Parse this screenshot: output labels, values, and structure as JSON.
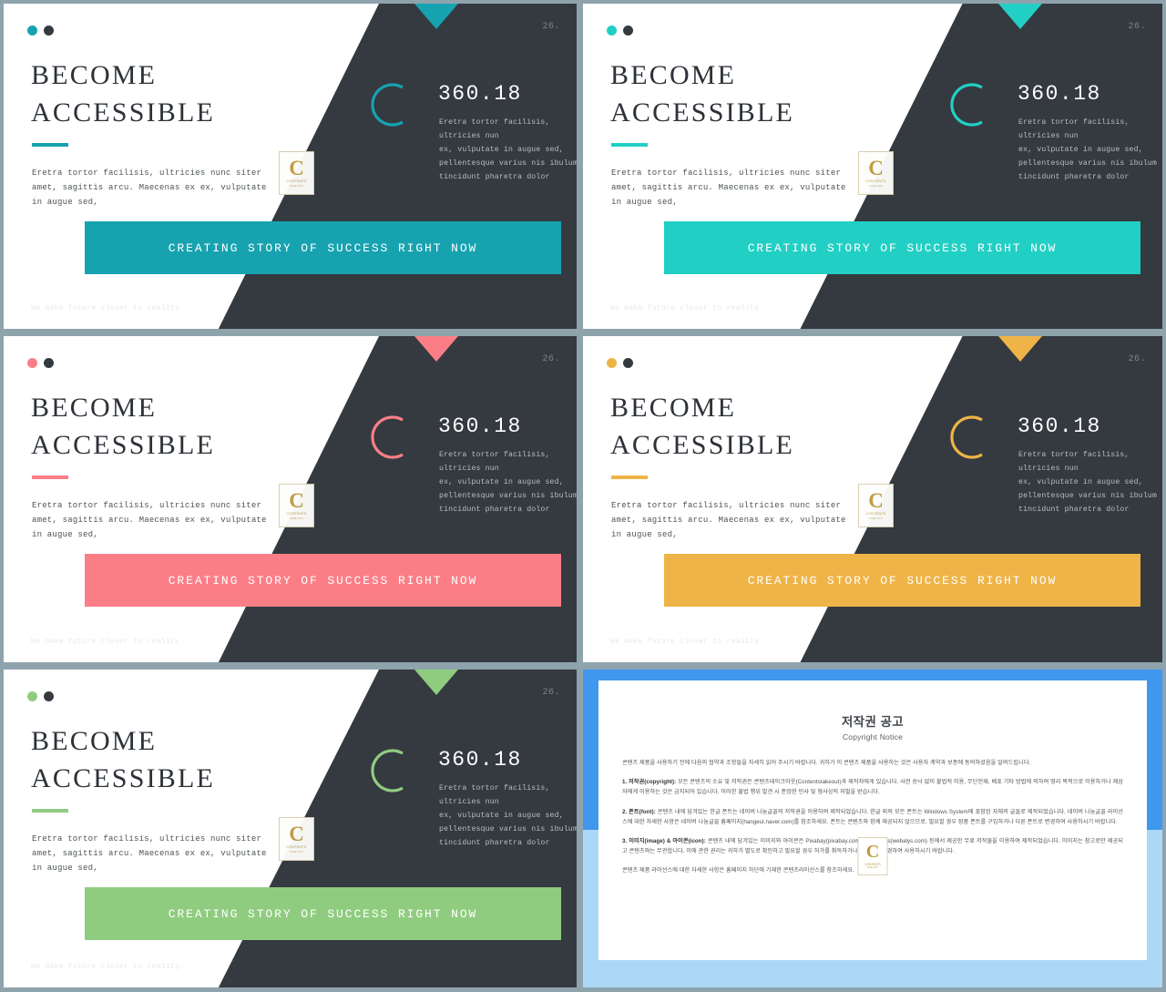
{
  "deck": {
    "page_number": "26.",
    "headline_line1": "BECOME",
    "headline_line2": "ACCESSIBLE",
    "stat_value": "360.18",
    "cta_label": "CREATING STORY OF SUCCESS RIGHT NOW",
    "tagline": "We make future closer to reality.",
    "left_paragraph": [
      "Eretra tortor facilisis, ultricies nunc siter",
      "amet, sagittis arcu. Maecenas ex ex, vulputate",
      "in augue sed,"
    ],
    "right_paragraph": [
      "Eretra tortor facilisis,",
      "ultricies nun",
      "ex, vulputate in augue sed,",
      "pellentesque varius nis ibulum",
      "tincidunt pharetra dolor"
    ],
    "logo": {
      "letter": "C",
      "name": "CONTENTS",
      "sub": "TAKE OUT"
    },
    "dark_color": "#343a40",
    "text_dark": "#2d3238"
  },
  "slides": [
    {
      "id": "slide-teal-dark",
      "accent": "#17a2b0",
      "accent_name": "teal"
    },
    {
      "id": "slide-turquoise",
      "accent": "#22cfc4",
      "accent_name": "turquoise"
    },
    {
      "id": "slide-coral",
      "accent": "#fb7e87",
      "accent_name": "coral"
    },
    {
      "id": "slide-amber",
      "accent": "#efb447",
      "accent_name": "amber"
    },
    {
      "id": "slide-green",
      "accent": "#90cc80",
      "accent_name": "green"
    }
  ],
  "copyright": {
    "title": "저작권 공고",
    "subtitle": "Copyright Notice",
    "frame_top_color": "#3f97ee",
    "frame_bottom_color": "#acd8f6",
    "paragraphs": [
      {
        "lead": "",
        "text": "콘텐츠 제품을 사용하기 전에 다음의 협약과 조항들을 자세히 읽어 주시기 바랍니다. 귀하가 이 콘텐츠 제품을 사용하는 것은 사용자 계약과 보증에 동의하셨음을 알려드립니다."
      },
      {
        "lead": "1. 저작권(copyright):",
        "text": " 모든 콘텐츠의 소유 및 저작권은 콘텐츠테이크아웃(Contentstakeout)과 제작자에게 있습니다. 사전 승낙 없이 불법적 이용, 무단전재, 배포 기타 방법에 의하여 영리 목적으로 이용하거나 제삼자에게 이용하는 것은 금지되어 있습니다. 이러한 불법 행위 발견 시 준엄한 민사 및 형사상의 처벌을 받습니다."
      },
      {
        "lead": "2. 폰트(font):",
        "text": " 콘텐츠 내에 담겨있는 한글 폰트는 네이버 나눔글꼴의 저작권을 이용하여 제작되었습니다. 한글 외의 모든 폰트는 Windows System에 포함된 자체의 글꼴로 제작되었습니다. 네이버 나눔글꼴 라이선스에 대한 자세한 사항은 네이버 나눔글꼴 홈페이지(hangeul.naver.com)를 참조하세요. 폰트는 콘텐츠와 함께 제공되지 않으므로, 필요할 경우 정품 폰트를 구입하거나 다른 폰트로 변경하여 사용하시기 바랍니다."
      },
      {
        "lead": "3. 이미지(image) & 아이콘(icon):",
        "text": " 콘텐츠 내에 담겨있는 이미지와 아이콘은 Pixabay(pixabay.com)와 Webalys(webalys.com) 등에서 제공한 무료 저작물을 이용하여 제작되었습니다. 이미지는 참고로만 제공되고 콘텐츠와는 무관합니다. 이에 관한 권리는 귀하가 별도로 확인하고 필요할 경우 허가를 취득하거나 이미지를 변경하여 사용하시기 바랍니다."
      },
      {
        "lead": "",
        "text": "콘텐츠 제품 라이선스에 대한 자세한 사항은 홈페이지 하단에 기재한 콘텐츠라이선스를 참조하세요."
      }
    ]
  }
}
